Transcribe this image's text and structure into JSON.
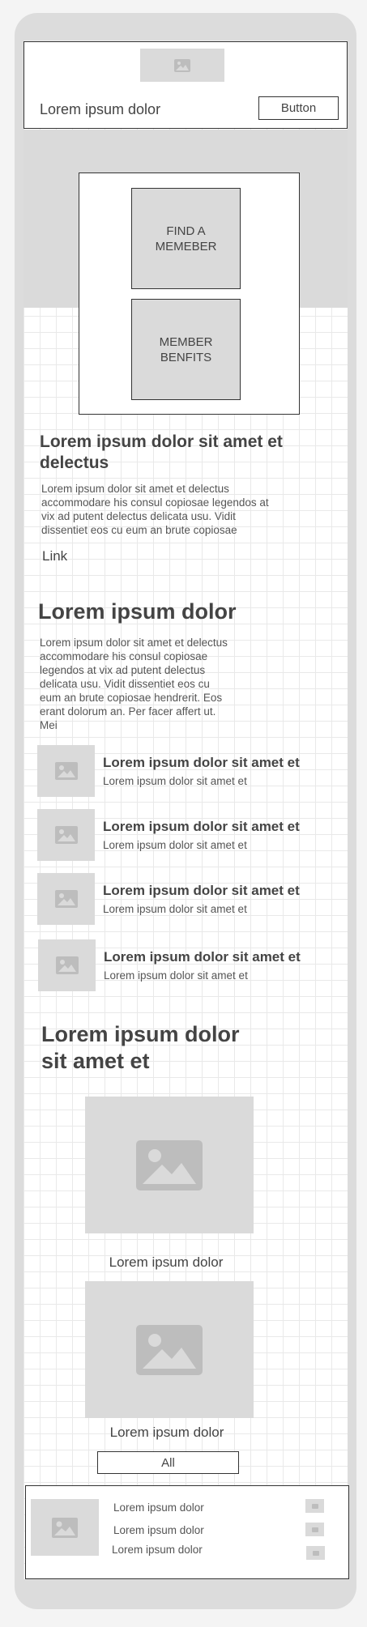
{
  "header": {
    "logo_icon": "image-placeholder-icon",
    "title": "Lorem ipsum dolor",
    "button_label": "Button"
  },
  "hero": {
    "tiles": [
      {
        "label_line1": "FIND A",
        "label_line2": "MEMEBER"
      },
      {
        "label_line1": "MEMBER",
        "label_line2": "BENFITS"
      }
    ]
  },
  "intro": {
    "heading_line1": "Lorem ipsum dolor sit amet et",
    "heading_line2": "delectus",
    "body_lines": [
      "Lorem ipsum dolor sit amet et delectus",
      "accommodare his consul copiosae legendos at",
      "vix ad putent delectus delicata usu. Vidit",
      "dissentiet eos cu eum an brute copiosae"
    ],
    "link": "Link"
  },
  "section2": {
    "heading": "Lorem ipsum dolor",
    "body_lines": [
      "Lorem ipsum dolor sit amet et delectus",
      "accommodare his consul copiosae",
      "legendos at vix ad putent delectus",
      "delicata usu. Vidit dissentiet eos cu",
      "eum an brute copiosae hendrerit. Eos",
      "erant dolorum an. Per facer affert ut.",
      "Mei"
    ],
    "items": [
      {
        "title": "Lorem ipsum dolor sit amet et",
        "subtitle": "Lorem ipsum dolor sit amet et"
      },
      {
        "title": "Lorem ipsum dolor sit amet et",
        "subtitle": "Lorem ipsum dolor sit amet et"
      },
      {
        "title": "Lorem ipsum dolor sit amet et",
        "subtitle": "Lorem ipsum dolor sit amet et"
      },
      {
        "title": "Lorem ipsum dolor sit amet et",
        "subtitle": "Lorem ipsum dolor sit amet et"
      }
    ]
  },
  "gallery": {
    "heading_line1": "Lorem ipsum dolor",
    "heading_line2": "sit amet et",
    "cards": [
      {
        "caption": "Lorem ipsum dolor"
      },
      {
        "caption": "Lorem ipsum dolor"
      }
    ],
    "all_button": "All"
  },
  "footer": {
    "links": [
      "Lorem ipsum dolor",
      "Lorem ipsum dolor",
      "Lorem ipsum dolor"
    ]
  },
  "colors": {
    "placeholder": "#dadada",
    "frame": "#dcdcdc",
    "text": "#444444"
  }
}
